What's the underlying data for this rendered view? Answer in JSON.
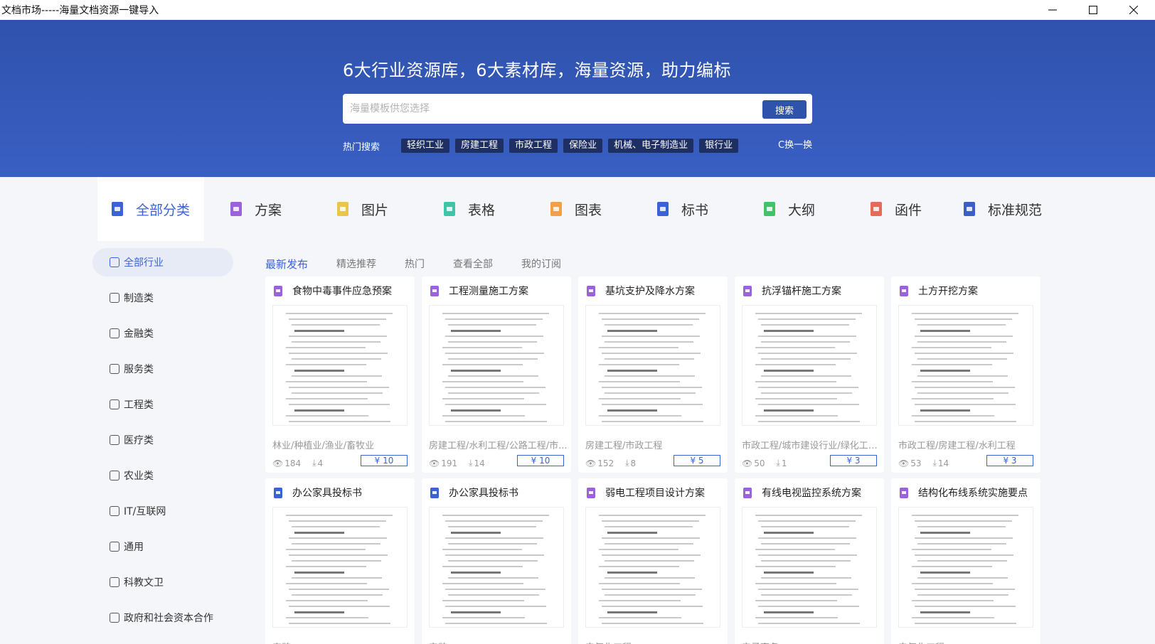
{
  "window": {
    "title": "文档市场-----海量文档资源一键导入"
  },
  "hero": {
    "title": "6大行业资源库，6大素材库，海量资源，助力编标",
    "search_placeholder": "海量模板供您选择",
    "search_button": "搜索",
    "hot_label": "热门搜索",
    "hot_tags": [
      "轻织工业",
      "房建工程",
      "市政工程",
      "保险业",
      "机械、电子制造业",
      "银行业"
    ],
    "swap_label": "C换一换"
  },
  "categories": [
    {
      "label": "全部分类",
      "icon": "grid-doc-icon",
      "color": "#3b63d6",
      "active": true
    },
    {
      "label": "方案",
      "icon": "doc-icon",
      "color": "#9a63d9"
    },
    {
      "label": "图片",
      "icon": "image-icon",
      "color": "#e9c64b"
    },
    {
      "label": "表格",
      "icon": "sheet-icon",
      "color": "#3fc4a7"
    },
    {
      "label": "图表",
      "icon": "chart-icon",
      "color": "#f0a04b"
    },
    {
      "label": "标书",
      "icon": "doc-icon",
      "color": "#3b63d6"
    },
    {
      "label": "大纲",
      "icon": "outline-icon",
      "color": "#3fc46a"
    },
    {
      "label": "函件",
      "icon": "letter-icon",
      "color": "#e66a5a"
    },
    {
      "label": "标准规范",
      "icon": "layers-icon",
      "color": "#3b5fc3"
    }
  ],
  "sidebar": [
    {
      "label": "全部行业",
      "icon": "grid-icon",
      "active": true
    },
    {
      "label": "制造类",
      "icon": "gear-icon"
    },
    {
      "label": "金融类",
      "icon": "coins-icon"
    },
    {
      "label": "服务类",
      "icon": "heart-hand-icon"
    },
    {
      "label": "工程类",
      "icon": "building-icon"
    },
    {
      "label": "医疗类",
      "icon": "medkit-icon"
    },
    {
      "label": "农业类",
      "icon": "wheat-icon"
    },
    {
      "label": "IT/互联网",
      "icon": "globe-icon"
    },
    {
      "label": "通用",
      "icon": "folder-icon"
    },
    {
      "label": "科教文卫",
      "icon": "graduation-icon"
    },
    {
      "label": "政府和社会资本合作",
      "icon": "government-icon"
    }
  ],
  "tabs": [
    {
      "label": "最新发布",
      "active": true
    },
    {
      "label": "精选推荐"
    },
    {
      "label": "热门"
    },
    {
      "label": "查看全部"
    },
    {
      "label": "我的订阅"
    }
  ],
  "cards": [
    {
      "title": "食物中毒事件应急预案",
      "icon_color": "#9a63d9",
      "tags": "林业/种植业/渔业/畜牧业",
      "views": "184",
      "downloads": "4",
      "price": "¥ 10"
    },
    {
      "title": "工程测量施工方案",
      "icon_color": "#9a63d9",
      "tags": "房建工程/水利工程/公路工程/市...",
      "views": "191",
      "downloads": "14",
      "price": "¥ 10"
    },
    {
      "title": "基坑支护及降水方案",
      "icon_color": "#9a63d9",
      "tags": "房建工程/市政工程",
      "views": "152",
      "downloads": "8",
      "price": "¥ 5"
    },
    {
      "title": "抗浮锚杆施工方案",
      "icon_color": "#9a63d9",
      "tags": "市政工程/城市建设行业/绿化工程...",
      "views": "50",
      "downloads": "1",
      "price": "¥ 3"
    },
    {
      "title": "土方开挖方案",
      "icon_color": "#9a63d9",
      "tags": "市政工程/房建工程/水利工程",
      "views": "53",
      "downloads": "14",
      "price": "¥ 3"
    },
    {
      "title": "办公家具投标书",
      "icon_color": "#3b63d6",
      "tags": "安装",
      "views": "",
      "downloads": "",
      "price": ""
    },
    {
      "title": "办公家具投标书",
      "icon_color": "#3b63d6",
      "tags": "安装",
      "views": "",
      "downloads": "",
      "price": ""
    },
    {
      "title": "弱电工程项目设计方案",
      "icon_color": "#9a63d9",
      "tags": "电气化工程",
      "views": "",
      "downloads": "",
      "price": ""
    },
    {
      "title": "有线电视监控系统方案",
      "icon_color": "#9a63d9",
      "tags": "电子商务",
      "views": "",
      "downloads": "",
      "price": ""
    },
    {
      "title": "结构化布线系统实施要点",
      "icon_color": "#9a63d9",
      "tags": "电气化工程",
      "views": "",
      "downloads": "",
      "price": ""
    }
  ]
}
